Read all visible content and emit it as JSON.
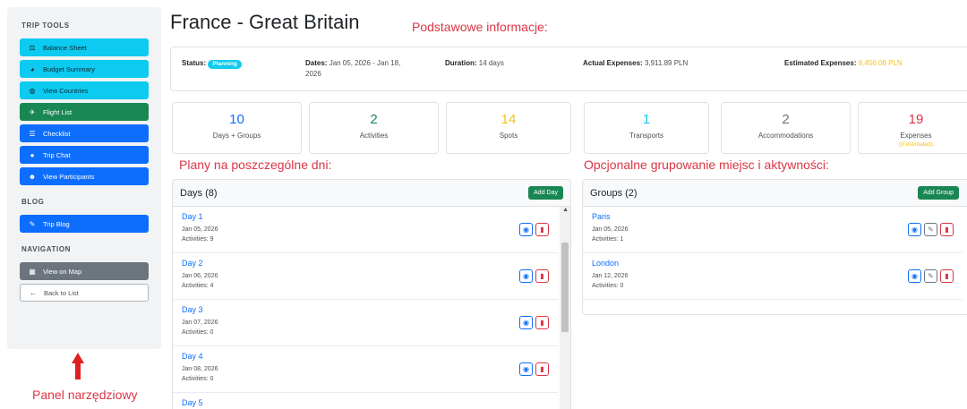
{
  "sidebar": {
    "trip_tools_title": "TRIP TOOLS",
    "trip_tools": [
      {
        "label": "Balance Sheet",
        "icon": "balance-icon",
        "glyph": "⚖",
        "color": "cyan"
      },
      {
        "label": "Budget Summary",
        "icon": "pie-icon",
        "glyph": "◕",
        "color": "cyan"
      },
      {
        "label": "View Countries",
        "icon": "globe-icon",
        "glyph": "◍",
        "color": "cyan"
      },
      {
        "label": "Flight List",
        "icon": "plane-icon",
        "glyph": "✈",
        "color": "green"
      },
      {
        "label": "Checklist",
        "icon": "checklist-icon",
        "glyph": "☰",
        "color": "blue"
      },
      {
        "label": "Trip Chat",
        "icon": "chat-icon",
        "glyph": "●",
        "color": "blue"
      },
      {
        "label": "View Participants",
        "icon": "people-icon",
        "glyph": "☻",
        "color": "blue"
      }
    ],
    "blog_title": "BLOG",
    "blog_label": "Trip Blog",
    "navigation_title": "NAVIGATION",
    "map_label": "View on Map",
    "back_label": "Back to List",
    "panel_label": "Panel narzędziowy"
  },
  "header": {
    "title": "France - Great Britain",
    "annotation_basic": "Podstawowe informacje:",
    "annotation_days": "Plany na poszczególne dni:",
    "annotation_groups": "Opcjonalne grupowanie miejsc i aktywności:"
  },
  "info": {
    "status_label": "Status:",
    "status_value": "Planning",
    "dates_label": "Dates:",
    "dates_value": "Jan 05, 2026 - Jan 18,",
    "dates_value_2": "2026",
    "duration_label": "Duration:",
    "duration_value": "14 days",
    "actual_label": "Actual Expenses:",
    "actual_value": "3,911.89 PLN",
    "estimated_label": "Estimated Expenses:",
    "estimated_value": "8,456.08 PLN"
  },
  "stats": [
    {
      "num": "10",
      "label": "Days + Groups",
      "color": "#0d6efd"
    },
    {
      "num": "2",
      "label": "Activities",
      "color": "#198754"
    },
    {
      "num": "14",
      "label": "Spots",
      "color": "#ffc107"
    },
    {
      "num": "1",
      "label": "Transports",
      "color": "#0dcaf0"
    },
    {
      "num": "2",
      "label": "Accommodations",
      "color": "#6c757d"
    },
    {
      "num": "19",
      "label": "Expenses",
      "sub": "(9 estimated)",
      "color": "#dc3545"
    }
  ],
  "days": {
    "title": "Days (8)",
    "add_label": "Add Day",
    "items": [
      {
        "name": "Day 1",
        "date": "Jan 05, 2026",
        "activities": "Activities: 9"
      },
      {
        "name": "Day 2",
        "date": "Jan 06, 2026",
        "activities": "Activities: 4"
      },
      {
        "name": "Day 3",
        "date": "Jan 07, 2026",
        "activities": "Activities: 0"
      },
      {
        "name": "Day 4",
        "date": "Jan 08, 2026",
        "activities": "Activities: 0"
      },
      {
        "name": "Day 5"
      }
    ]
  },
  "groups": {
    "title": "Groups (2)",
    "add_label": "Add Group",
    "items": [
      {
        "name": "Paris",
        "date": "Jan 05, 2026",
        "activities": "Activities: 1"
      },
      {
        "name": "London",
        "date": "Jan 12, 2026",
        "activities": "Activities: 0"
      }
    ]
  }
}
